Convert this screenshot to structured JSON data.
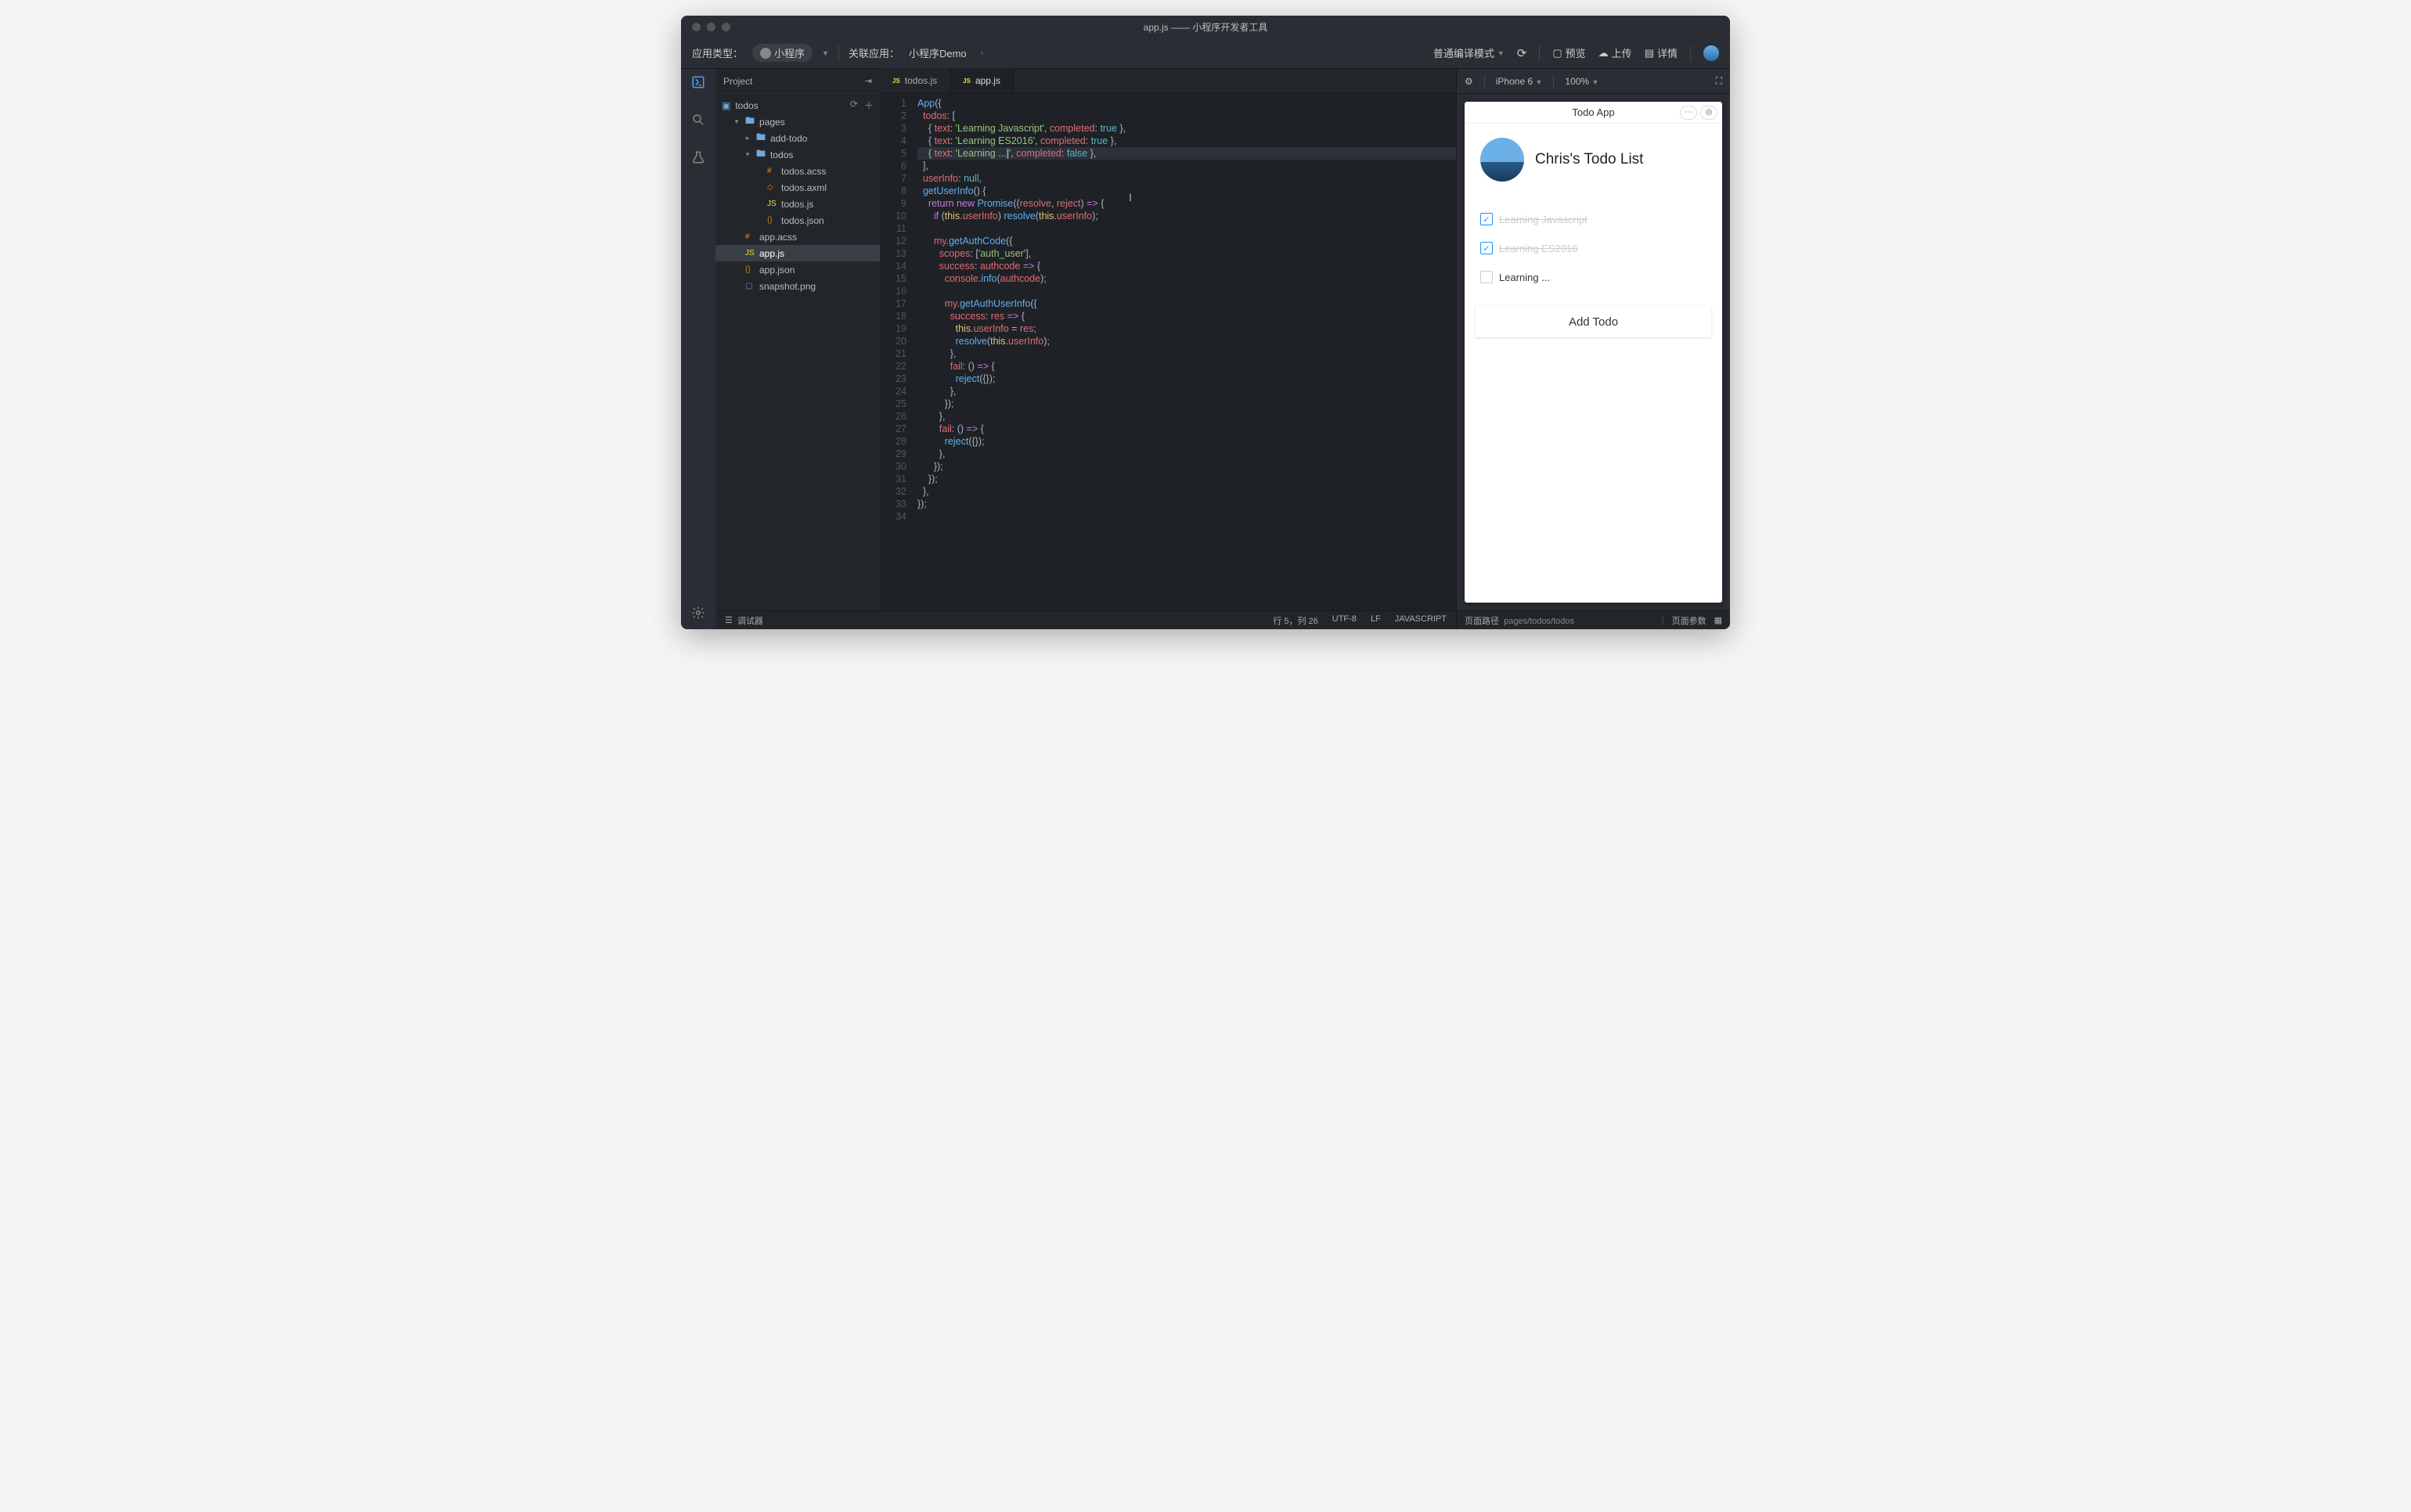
{
  "window_title": "app.js —— 小程序开发者工具",
  "toolbar": {
    "app_type_label": "应用类型：",
    "app_type_value": "小程序",
    "linked_app_label": "关联应用：",
    "linked_app_value": "小程序Demo",
    "compile_mode": "普通编译模式",
    "preview": "预览",
    "upload": "上传",
    "details": "详情"
  },
  "sidebar": {
    "title": "Project",
    "root": "todos",
    "items": [
      {
        "name": "pages",
        "type": "folder",
        "depth": 1,
        "open": true
      },
      {
        "name": "add-todo",
        "type": "folder",
        "depth": 2,
        "open": false
      },
      {
        "name": "todos",
        "type": "folder",
        "depth": 2,
        "open": true
      },
      {
        "name": "todos.acss",
        "type": "css",
        "depth": 3
      },
      {
        "name": "todos.axml",
        "type": "html",
        "depth": 3
      },
      {
        "name": "todos.js",
        "type": "js",
        "depth": 3
      },
      {
        "name": "todos.json",
        "type": "json",
        "depth": 3
      },
      {
        "name": "app.acss",
        "type": "css",
        "depth": 1
      },
      {
        "name": "app.js",
        "type": "js",
        "depth": 1,
        "selected": true
      },
      {
        "name": "app.json",
        "type": "json",
        "depth": 1
      },
      {
        "name": "snapshot.png",
        "type": "img",
        "depth": 1
      }
    ]
  },
  "tabs": [
    {
      "label": "todos.js",
      "active": false
    },
    {
      "label": "app.js",
      "active": true
    }
  ],
  "code_lines": 34,
  "status": {
    "debugger": "调试器",
    "pos": "行 5，列 26",
    "encoding": "UTF-8",
    "eol": "LF",
    "lang": "JAVASCRIPT"
  },
  "preview": {
    "device": "iPhone 6",
    "zoom": "100%",
    "app_title": "Todo App",
    "list_title": "Chris's Todo List",
    "add_button": "Add Todo",
    "route_label": "页面路径",
    "route_value": "pages/todos/todos",
    "params_label": "页面参数"
  },
  "todos_data": [
    {
      "text": "Learning Javascript",
      "completed": true
    },
    {
      "text": "Learning ES2016",
      "completed": true
    },
    {
      "text": "Learning ...",
      "completed": false
    }
  ]
}
